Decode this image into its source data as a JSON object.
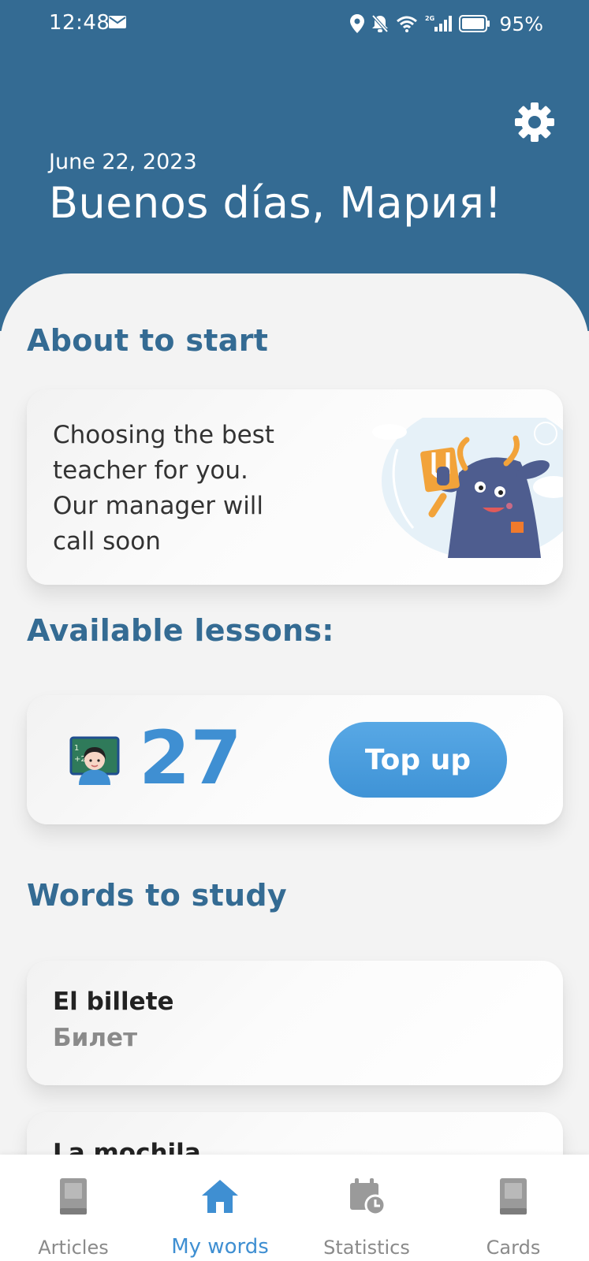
{
  "status_bar": {
    "time": "12:48",
    "battery": "95%",
    "network": "2G"
  },
  "header": {
    "date": "June 22, 2023",
    "greeting": "Buenos días, Мария!"
  },
  "about": {
    "title": "About to start",
    "text": "Choosing the best\nteacher for you.\n Our manager will\ncall soon"
  },
  "lessons": {
    "title": "Available lessons:",
    "count": "27",
    "topup_label": "Top up"
  },
  "words": {
    "title": "Words to study",
    "items": [
      {
        "word": "El billete",
        "translation": "Билет"
      },
      {
        "word": "La mochila",
        "translation": ""
      }
    ]
  },
  "nav": {
    "items": [
      {
        "label": "Articles",
        "icon": "book-icon",
        "active": false
      },
      {
        "label": "My words",
        "icon": "home-icon",
        "active": true
      },
      {
        "label": "Statistics",
        "icon": "calendar-clock-icon",
        "active": false
      },
      {
        "label": "Cards",
        "icon": "card-icon",
        "active": false
      }
    ]
  },
  "colors": {
    "header_bg": "#346b93",
    "accent": "#3f8fd2",
    "title_blue": "#346b93"
  }
}
